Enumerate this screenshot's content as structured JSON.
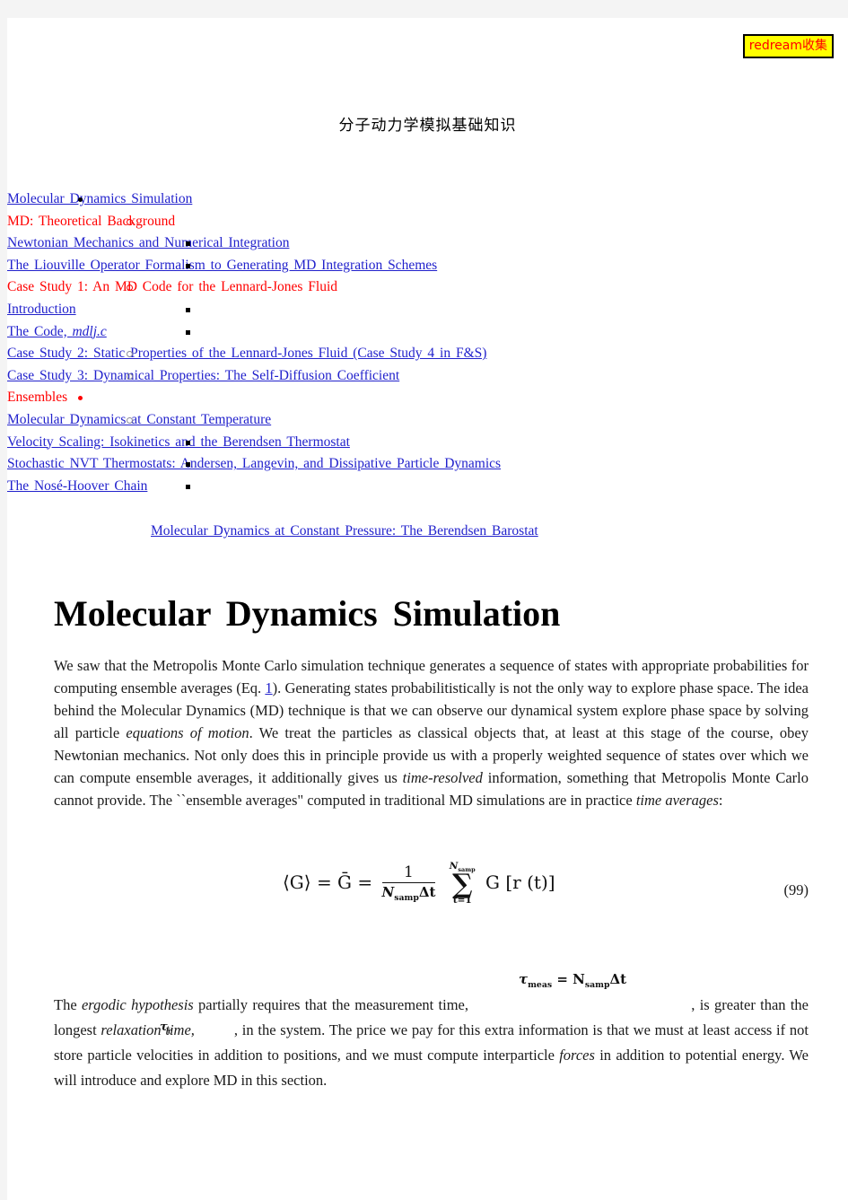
{
  "watermark": {
    "label": "redream收集"
  },
  "document": {
    "title_cn": "分子动力学模拟基础知识",
    "heading": "Molecular  Dynamics  Simulation"
  },
  "toc": {
    "items": [
      {
        "level": 1,
        "marker": "disc-black",
        "style": "link",
        "label": "Molecular  Dynamics  Simulation"
      },
      {
        "level": 2,
        "marker": "circle-red",
        "style": "red",
        "label": "MD:  Theoretical  Background"
      },
      {
        "level": 3,
        "marker": "square-black",
        "style": "link",
        "label": "Newtonian  Mechanics  and  Numerical  Integration"
      },
      {
        "level": 3,
        "marker": "square-black",
        "style": "link",
        "label": "The  Liouville  Operator  Formalism  to  Generating  MD  Integration  Schemes"
      },
      {
        "level": 2,
        "marker": "circle-red",
        "style": "red",
        "label": "Case  Study  1:  An  MD  Code  for  the  Lennard-Jones  Fluid"
      },
      {
        "level": 3,
        "marker": "square-black",
        "style": "link",
        "label": "Introduction"
      },
      {
        "level": 3,
        "marker": "square-black",
        "style": "link",
        "label_prefix": "The  Code,  ",
        "label_italic": "mdlj.c",
        "label": "The  Code,  mdlj.c"
      },
      {
        "level": 2,
        "marker": "circle-grey",
        "style": "link",
        "label": "Case  Study  2:  Static  Properties  of  the  Lennard-Jones  Fluid  (Case  Study  4  in  F&S)"
      },
      {
        "level": 2,
        "marker": "circle-grey",
        "style": "link",
        "label": "Case  Study  3:  Dynamical  Properties:  The  Self-Diffusion  Coefficient"
      },
      {
        "level": 1,
        "marker": "disc-red",
        "style": "red",
        "label": "Ensembles"
      },
      {
        "level": 2,
        "marker": "circle-grey",
        "style": "link",
        "label": "Molecular  Dynamics  at  Constant  Temperature"
      },
      {
        "level": 3,
        "marker": "square-black",
        "style": "link",
        "label": "Velocity  Scaling:  Isokinetics  and  the  Berendsen  Thermostat"
      },
      {
        "level": 3,
        "marker": "square-black",
        "style": "link",
        "label": "Stochastic  NVT  Thermostats:  Andersen,  Langevin,  and  Dissipative  Particle  Dynamics"
      },
      {
        "level": 3,
        "marker": "square-black",
        "style": "link",
        "label": "The  Nosé-Hoover  Chain"
      }
    ],
    "standalone_link": "Molecular  Dynamics  at  Constant  Pressure:  The  Berendsen  Barostat"
  },
  "body": {
    "para1_a": "We saw that the Metropolis Monte Carlo simulation technique generates a sequence of states with appropriate probabilities for computing ensemble averages (Eq. ",
    "para1_link": "1",
    "para1_b": "). Generating states probabilitistically is not the only way to explore phase space. The idea behind the Molecular Dynamics (MD) technique is that we can observe our dynamical system explore phase space by solving all particle ",
    "para1_i1": "equations of motion",
    "para1_c": ". We treat the particles as classical objects that, at least at this stage of the course, obey Newtonian mechanics. Not only does this in principle provide us with a properly weighted sequence of states over which we can compute ensemble averages, it additionally gives us ",
    "para1_i2": "time-resolved",
    "para1_d": " information, something that Metropolis Monte Carlo cannot provide. The ``ensemble averages\" computed in traditional MD simulations are in practice ",
    "para1_i3": "time averages",
    "para1_e": ":",
    "para2_a": "The ",
    "para2_i1": "ergodic hypothesis",
    "para2_b": " partially requires that the measurement time, ",
    "para2_c": ", is greater than the longest ",
    "para2_i2": "relaxation time,",
    "para2_d": ", in the system. The price we pay for this extra information is that we must at least access if not store particle velocities in addition to positions, and we must compute interparticle ",
    "para2_i3": "forces",
    "para2_e": " in addition to potential energy. We will introduce and explore MD in this section."
  },
  "equation": {
    "number": "(99)",
    "lhs": "⟨G⟩ = Ḡ =",
    "fraction_numerator": "1",
    "fraction_denominator_N": "N",
    "fraction_denominator_sub": "samp",
    "fraction_denominator_dt": "Δt",
    "sum_upper_N": "N",
    "sum_upper_sub": "samp",
    "sum_symbol": "∑",
    "sum_lower": "t=1",
    "summand": "G [r (t)]",
    "inline_meas_tau": "τ",
    "inline_meas_sub": "meas",
    "inline_meas_eq": " = N",
    "inline_meas_nsub": "samp",
    "inline_meas_dt": "Δt",
    "inline_tau_symbol": "τ",
    "inline_tau_sub": "r"
  },
  "colors": {
    "link": "#2222cc",
    "red": "#ff0000",
    "badge_bg": "#ffff00",
    "badge_text": "#ff0000",
    "page_bg": "#ffffff",
    "canvas_bg": "#f4f4f4"
  }
}
